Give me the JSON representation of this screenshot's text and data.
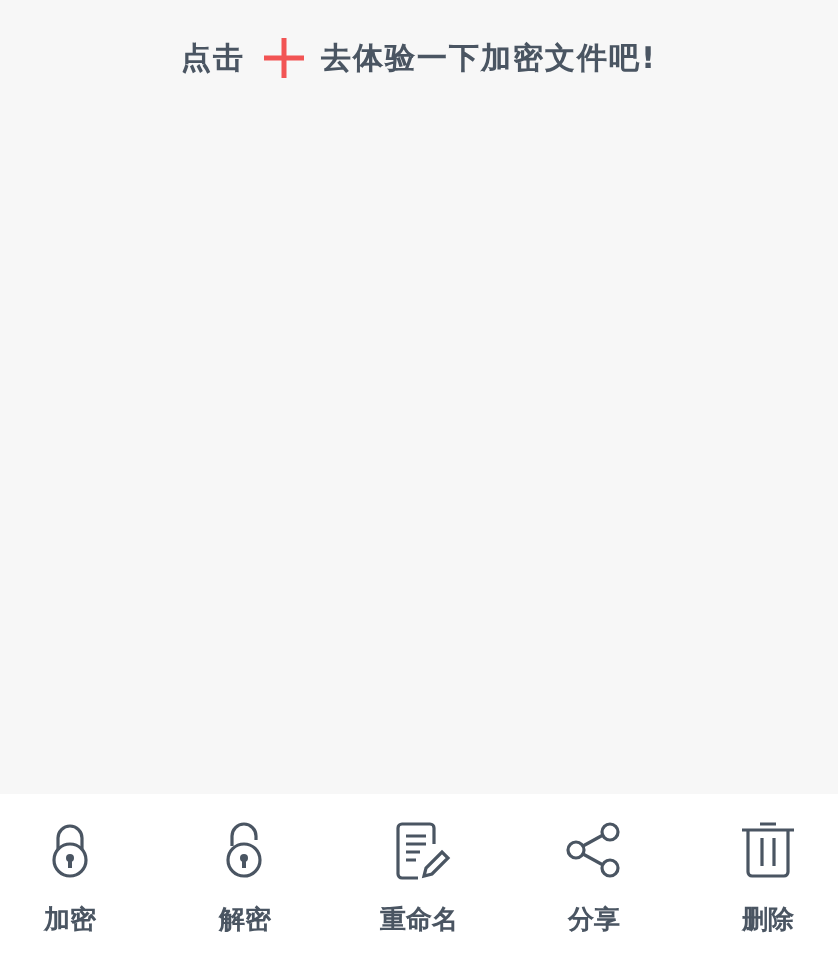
{
  "hint": {
    "before": "点击",
    "after": "去体验一下加密文件吧!"
  },
  "toolbar": [
    {
      "kind": "lock",
      "label": "加密"
    },
    {
      "kind": "unlock",
      "label": "解密"
    },
    {
      "kind": "rename",
      "label": "重命名"
    },
    {
      "kind": "share",
      "label": "分享"
    },
    {
      "kind": "delete",
      "label": "删除"
    }
  ]
}
